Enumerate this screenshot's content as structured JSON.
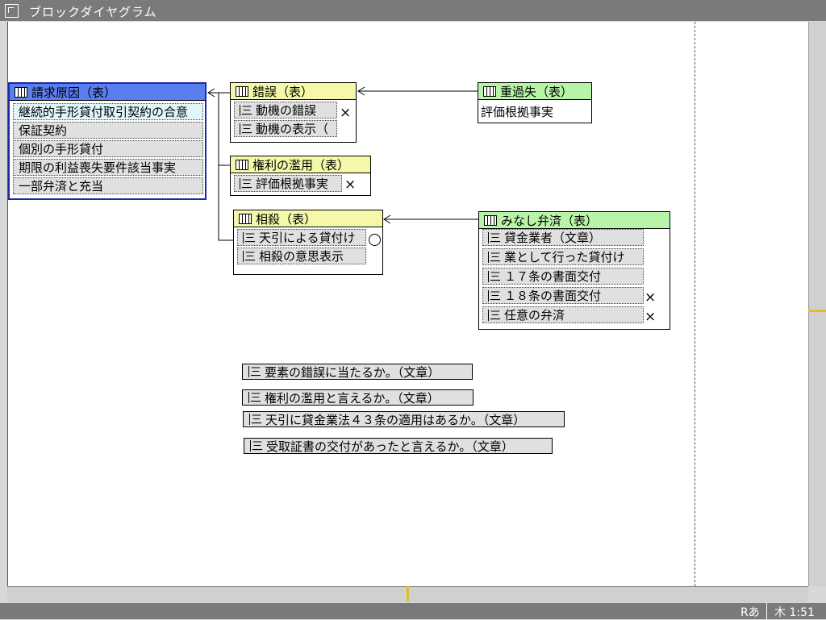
{
  "window": {
    "title": "ブロックダイヤグラム"
  },
  "status": {
    "ime": "Rあ",
    "clock": "木 1:51"
  },
  "tables": {
    "seikyu": {
      "title": "請求原因（表）",
      "rows": [
        "継続的手形貸付取引契約の合意",
        "保証契約",
        "個別の手形貸付",
        "期限の利益喪失要件該当事実",
        "一部弁済と充当"
      ]
    },
    "sakugo": {
      "title": "錯誤（表）",
      "rows": [
        "動機の錯誤",
        "動機の表示（"
      ]
    },
    "juukashitsu": {
      "title": "重過失（表）",
      "rows": [
        "評価根拠事実"
      ]
    },
    "kenri": {
      "title": "権利の濫用（表）",
      "rows": [
        "評価根拠事実"
      ]
    },
    "sousai": {
      "title": "相殺（表）",
      "rows": [
        "天引による貸付け",
        "相殺の意思表示"
      ]
    },
    "minashi": {
      "title": "みなし弁済（表）",
      "rows": [
        "貸金業者（文章）",
        "業として行った貸付け",
        "１７条の書面交付",
        "１８条の書面交付",
        "任意の弁済"
      ]
    }
  },
  "marks": {
    "x": "×"
  },
  "questions": [
    "要素の錯誤に当たるか。（文章）",
    "権利の濫用と言えるか。（文章）",
    "天引に貸金業法４３条の適用はあるか。（文章）",
    "受取証書の交付があったと言えるか。（文章）"
  ]
}
